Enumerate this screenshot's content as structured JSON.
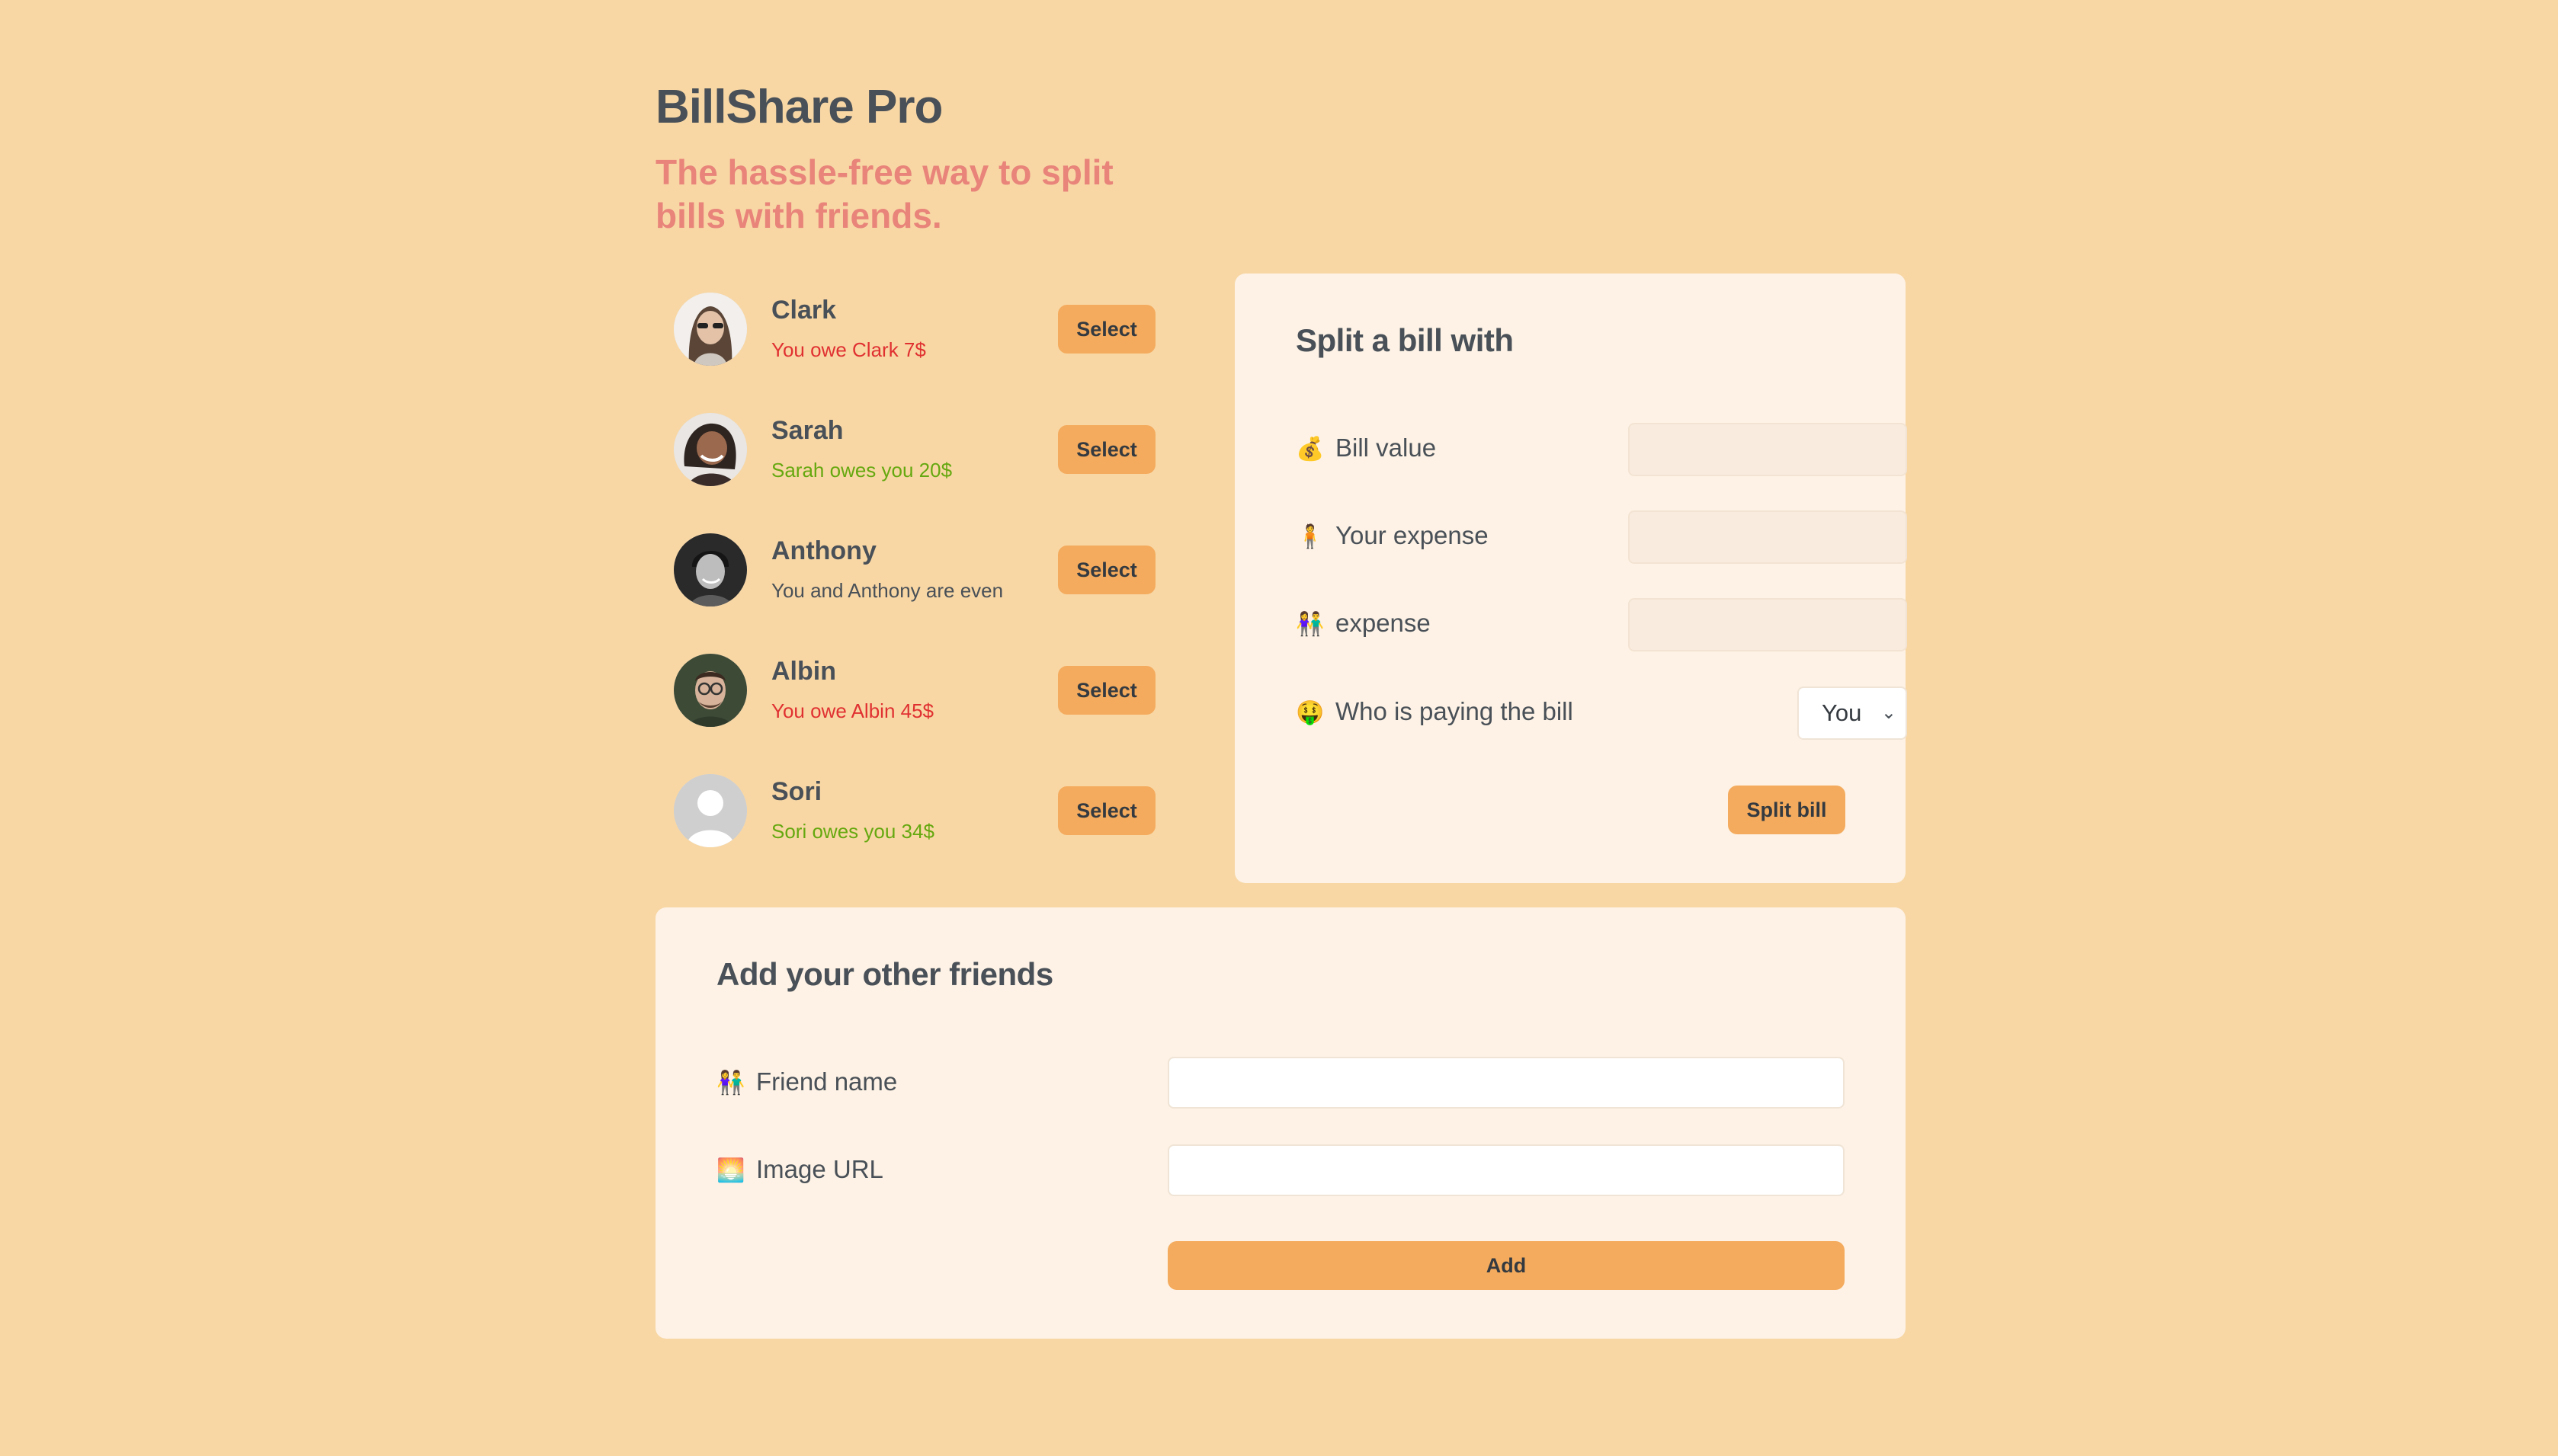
{
  "app": {
    "title": "BillShare Pro",
    "subtitle": "The hassle-free way to split bills with friends."
  },
  "friends": [
    {
      "name": "Clark",
      "status": "You owe Clark 7$",
      "status_type": "owe",
      "select_label": "Select"
    },
    {
      "name": "Sarah",
      "status": "Sarah owes you 20$",
      "status_type": "owed",
      "select_label": "Select"
    },
    {
      "name": "Anthony",
      "status": "You and Anthony are even",
      "status_type": "even",
      "select_label": "Select"
    },
    {
      "name": "Albin",
      "status": "You owe Albin 45$",
      "status_type": "owe",
      "select_label": "Select"
    },
    {
      "name": "Sori",
      "status": "Sori owes you 34$",
      "status_type": "owed",
      "select_label": "Select"
    }
  ],
  "split_form": {
    "title": "Split a bill with",
    "bill_value_icon": "💰",
    "bill_value_label": "Bill value",
    "bill_value": "",
    "your_expense_icon": "🧍",
    "your_expense_label": "Your expense",
    "your_expense": "",
    "friend_expense_icon": "👫",
    "friend_expense_label": "expense",
    "friend_expense": "",
    "payer_icon": "🤑",
    "payer_label": "Who is paying the bill",
    "payer_selected": "You",
    "submit_label": "Split bill"
  },
  "add_form": {
    "title": "Add your other friends",
    "name_icon": "👫",
    "name_label": "Friend name",
    "name_value": "",
    "image_icon": "🌅",
    "image_label": "Image URL",
    "image_value": "",
    "submit_label": "Add"
  },
  "colors": {
    "background": "#f8d7a5",
    "panel": "#fdf2e5",
    "accent": "#f4ab5d",
    "subtitle": "#e8847a",
    "owe": "#e03131",
    "owed": "#66a80f"
  }
}
